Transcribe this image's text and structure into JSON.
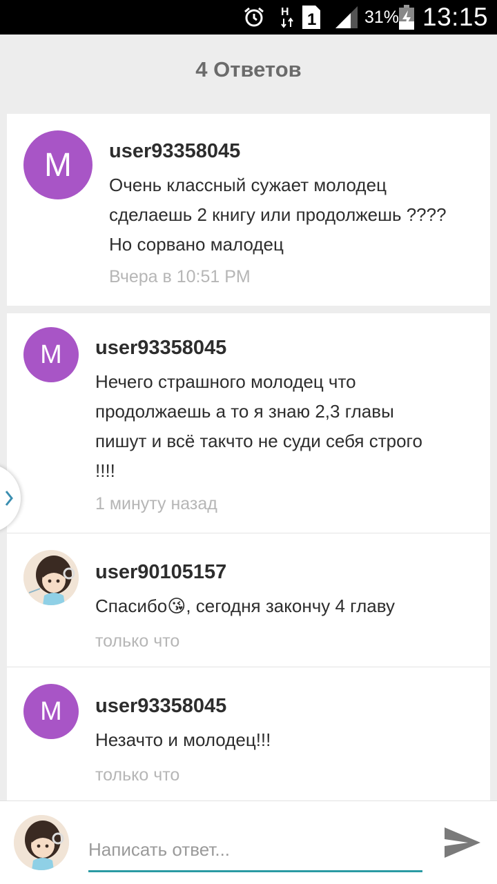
{
  "status_bar": {
    "network_type": "H",
    "sim_slot": "1",
    "battery_percent": "31%",
    "time": "13:15",
    "icons": [
      "alarm-icon",
      "network-h-icon",
      "sim-icon",
      "signal-icon",
      "battery-charging-icon"
    ]
  },
  "header": {
    "title": "4 Ответов"
  },
  "comments": [
    {
      "username": "user93358045",
      "avatar_letter": "M",
      "avatar_color": "#a855c6",
      "text_lines": [
        "Очень классный сужает молодец",
        "сделаешь 2 книгу или продолжешь ????",
        "Но сорвано малодец"
      ],
      "time": "Вчера в 10:51 PM"
    },
    {
      "username": "user93358045",
      "avatar_letter": "M",
      "avatar_color": "#a855c6",
      "text_lines": [
        "Нечего страшного молодец что",
        "продолжаешь а то я знаю 2,3 главы",
        "пишут и всё такчто не суди себя строго",
        "!!!!"
      ],
      "time": "1 минуту назад"
    },
    {
      "username": "user90105157",
      "avatar_icon": "anime-girl-avatar",
      "text_before_emoji": "Спасибо",
      "emoji": "😘",
      "text_after_emoji": ", сегодня закончу 4 главу",
      "time": "только что"
    },
    {
      "username": "user93358045",
      "avatar_letter": "M",
      "avatar_color": "#a855c6",
      "text_lines": [
        "Незачто и молодец!!!"
      ],
      "time": "только что"
    }
  ],
  "reply": {
    "placeholder": "Написать ответ...",
    "send_icon": "send-icon",
    "accent_color": "#2a9aa3"
  }
}
